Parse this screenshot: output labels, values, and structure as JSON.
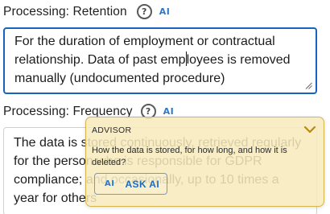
{
  "retention": {
    "label": "Processing: Retention",
    "help_symbol": "?",
    "ai_symbol": "AI",
    "value_before_caret": "For the duration of employment or contractual relationship. Data of past emp",
    "value_after_caret": "loyees is removed manually (undocumented procedure)"
  },
  "frequency": {
    "label": "Processing: Frequency",
    "help_symbol": "?",
    "ai_symbol": "AI",
    "value": "The data is stored continuously, retrieved regularly for the person who is responsible for GDPR compliance; and occasionally, up to 10 times a year for others"
  },
  "advisor": {
    "title": "ADVISOR",
    "text": "How the data is stored, for how long, and how it is deleted?",
    "ai_symbol": "AI",
    "ask_label": "ASK AI",
    "bg_color": "#f7eabb",
    "border_color": "#d6b64c",
    "accent_color": "#1e6cc0"
  }
}
